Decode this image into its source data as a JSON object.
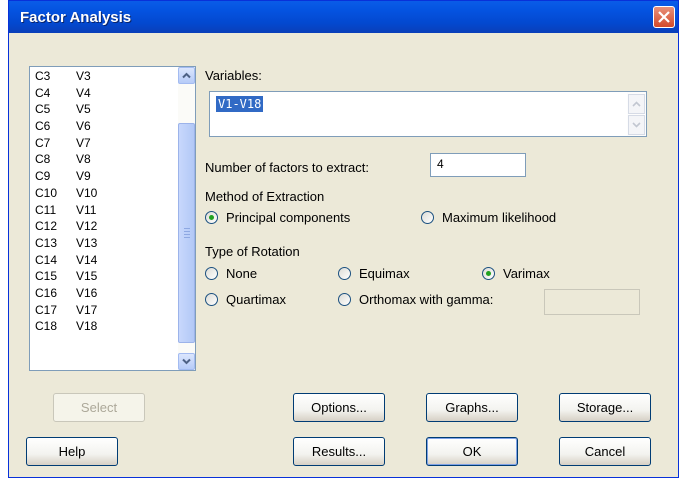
{
  "window": {
    "title": "Factor Analysis"
  },
  "columns_list": {
    "rows": [
      {
        "col": "C3",
        "var": "V3"
      },
      {
        "col": "C4",
        "var": "V4"
      },
      {
        "col": "C5",
        "var": "V5"
      },
      {
        "col": "C6",
        "var": "V6"
      },
      {
        "col": "C7",
        "var": "V7"
      },
      {
        "col": "C8",
        "var": "V8"
      },
      {
        "col": "C9",
        "var": "V9"
      },
      {
        "col": "C10",
        "var": "V10"
      },
      {
        "col": "C11",
        "var": "V11"
      },
      {
        "col": "C12",
        "var": "V12"
      },
      {
        "col": "C13",
        "var": "V13"
      },
      {
        "col": "C14",
        "var": "V14"
      },
      {
        "col": "C15",
        "var": "V15"
      },
      {
        "col": "C16",
        "var": "V16"
      },
      {
        "col": "C17",
        "var": "V17"
      },
      {
        "col": "C18",
        "var": "V18"
      }
    ]
  },
  "variables": {
    "label": "Variables:",
    "value": "V1-V18"
  },
  "num_factors": {
    "label": "Number of factors to extract:",
    "value": "4"
  },
  "extraction": {
    "label": "Method of Extraction",
    "options": [
      "Principal components",
      "Maximum likelihood"
    ],
    "selected": "Principal components"
  },
  "rotation": {
    "label": "Type of Rotation",
    "options": [
      "None",
      "Equimax",
      "Varimax",
      "Quartimax",
      "Orthomax with gamma:"
    ],
    "selected": "Varimax",
    "gamma_value": ""
  },
  "buttons": {
    "select": "Select",
    "options": "Options...",
    "graphs": "Graphs...",
    "storage": "Storage...",
    "help": "Help",
    "results": "Results...",
    "ok": "OK",
    "cancel": "Cancel"
  },
  "colors": {
    "dialog_bg": "#ece9d8",
    "titlebar": "#0453e0",
    "selection": "#316ac5",
    "close_button": "#d44a2a"
  }
}
